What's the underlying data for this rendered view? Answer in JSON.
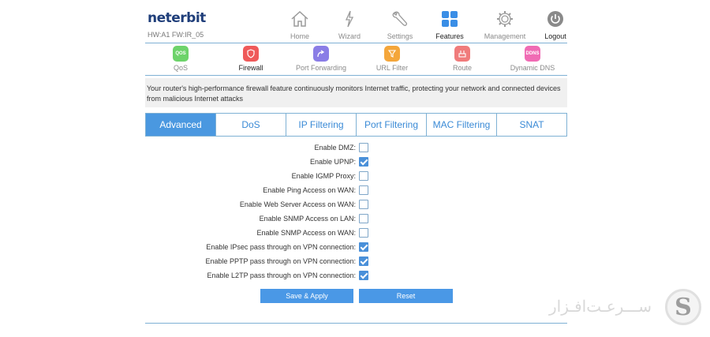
{
  "brand": {
    "logo": "neterbit",
    "hw_fw": "HW:A1 FW:IR_05"
  },
  "nav": [
    {
      "label": "Home",
      "icon": "house-icon",
      "active": false
    },
    {
      "label": "Wizard",
      "icon": "wand-icon",
      "active": false
    },
    {
      "label": "Settings",
      "icon": "wrench-icon",
      "active": false
    },
    {
      "label": "Features",
      "icon": "grid-icon",
      "active": true
    },
    {
      "label": "Management",
      "icon": "gear-icon",
      "active": false
    },
    {
      "label": "Logout",
      "icon": "logout-icon",
      "active": false
    }
  ],
  "subnav": [
    {
      "label": "QoS",
      "icon_text": "QOS",
      "color": "#6dd36a"
    },
    {
      "label": "Firewall",
      "icon_text": "",
      "color": "#ef5a5a"
    },
    {
      "label": "Port Forwarding",
      "icon_text": "",
      "color": "#8a7de6"
    },
    {
      "label": "URL Filter",
      "icon_text": "",
      "color": "#f4a63a"
    },
    {
      "label": "Route",
      "icon_text": "",
      "color": "#f07b7b"
    },
    {
      "label": "Dynamic DNS",
      "icon_text": "DDNS",
      "color": "#f06bb4"
    }
  ],
  "description": "Your router's high-performance firewall feature continuously monitors Internet traffic, protecting your network and connected devices from malicious Internet attacks",
  "tabs": [
    "Advanced",
    "DoS",
    "IP Filtering",
    "Port Filtering",
    "MAC Filtering",
    "SNAT"
  ],
  "options": [
    {
      "label": "Enable DMZ:",
      "checked": false
    },
    {
      "label": "Enable UPNP:",
      "checked": true
    },
    {
      "label": "Enable IGMP Proxy:",
      "checked": false
    },
    {
      "label": "Enable Ping Access on WAN:",
      "checked": false
    },
    {
      "label": "Enable Web Server Access on WAN:",
      "checked": false
    },
    {
      "label": "Enable SNMP Access on LAN:",
      "checked": false
    },
    {
      "label": "Enable SNMP Access on WAN:",
      "checked": false
    },
    {
      "label": "Enable IPsec pass through on VPN connection:",
      "checked": true
    },
    {
      "label": "Enable PPTP pass through on VPN connection:",
      "checked": true
    },
    {
      "label": "Enable L2TP pass through on VPN connection:",
      "checked": true
    }
  ],
  "buttons": {
    "save": "Save & Apply",
    "reset": "Reset"
  },
  "watermark": {
    "text": "ســـرعـت‌افـزار",
    "letter": "S"
  },
  "colors": {
    "accent": "#4a98e0",
    "line": "#7fb1d4",
    "logo": "#1f3e7a"
  }
}
